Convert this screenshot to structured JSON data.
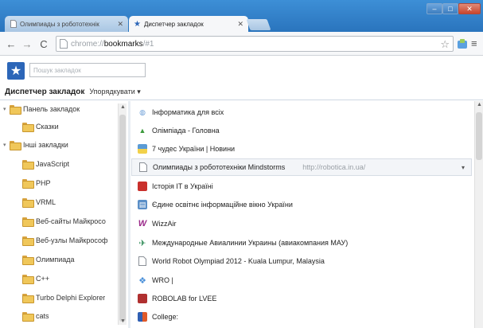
{
  "tabs": [
    {
      "label": "Олимпиады з робототехнік",
      "close": "✕",
      "active": false
    },
    {
      "label": "Диспетчер закладок",
      "close": "✕",
      "active": true
    }
  ],
  "window_controls": {
    "minimize": "–",
    "maximize": "□",
    "close": "✕"
  },
  "toolbar": {
    "back": "←",
    "forward": "→",
    "reload": "C",
    "url_scheme": "chrome://",
    "url_host": "bookmarks",
    "url_path": "/#1",
    "star": "☆",
    "menu": "≡"
  },
  "search": {
    "placeholder": "Пошук закладок",
    "value": ""
  },
  "manager": {
    "title": "Диспетчер закладок",
    "organize": "Упорядкувати ▾"
  },
  "tree": [
    {
      "label": "Панель закладок",
      "expanded": true,
      "level": 0
    },
    {
      "label": "Сказки",
      "level": 1
    },
    {
      "label": "Інші закладки",
      "expanded": true,
      "level": 0
    },
    {
      "label": "JavaScript",
      "level": 1
    },
    {
      "label": "PHP",
      "level": 1
    },
    {
      "label": "VRML",
      "level": 1
    },
    {
      "label": "Веб-сайты Майкросо",
      "level": 1
    },
    {
      "label": "Веб-узлы Майкрософ",
      "level": 1
    },
    {
      "label": "Олимпиада",
      "level": 1
    },
    {
      "label": "C++",
      "level": 1
    },
    {
      "label": "Turbo Delphi Explorer",
      "level": 1
    },
    {
      "label": "cats",
      "level": 1
    }
  ],
  "bookmarks": [
    {
      "title": "Інформатика для всіх",
      "url": "",
      "icon": "globe-icon",
      "color": "#6fa0d8",
      "glyph": "◍"
    },
    {
      "title": "Олімпіада - Головна",
      "url": "",
      "icon": "tree-icon",
      "color": "#3c9a3c",
      "glyph": "▲"
    },
    {
      "title": "7 чудес України | Новини",
      "url": "",
      "icon": "flag-icon",
      "color": "#e0c060",
      "glyph": "▬"
    },
    {
      "title": "Олимпиады з робототехніки Mindstorms",
      "url": "http://robotica.in.ua/",
      "icon": "page-icon",
      "color": "#ffffff",
      "glyph": "",
      "selected": true
    },
    {
      "title": "Історія IT в Україні",
      "url": "",
      "icon": "book-icon",
      "color": "#c9302c",
      "glyph": ""
    },
    {
      "title": "Єдине освітнє інформаційне вікно України",
      "url": "",
      "icon": "window-icon",
      "color": "#5b8fc7",
      "glyph": "▤"
    },
    {
      "title": "WizzAir",
      "url": "",
      "icon": "wizzair-icon",
      "color": "#9b2a8a",
      "glyph": "W"
    },
    {
      "title": "Международные Авиалинии Украины (авиакомпания МАУ)",
      "url": "",
      "icon": "plane-icon",
      "color": "#2e8b57",
      "glyph": "✈"
    },
    {
      "title": "World Robot Olympiad 2012 - Kuala Lumpur, Malaysia",
      "url": "",
      "icon": "page-icon",
      "color": "#ffffff",
      "glyph": ""
    },
    {
      "title": "WRO |",
      "url": "",
      "icon": "wro-icon",
      "color": "#4a90d9",
      "glyph": "❖"
    },
    {
      "title": "ROBOLAB for LVEE",
      "url": "",
      "icon": "robolab-icon",
      "color": "#b03030",
      "glyph": "▦"
    },
    {
      "title": "College:",
      "url": "",
      "icon": "college-icon",
      "color": "#2f5fb3",
      "glyph": "▙"
    }
  ],
  "row_menu": "▾",
  "colors": {
    "titlebar": "#3d8fd6",
    "logo": "#2c66b8",
    "folder": "#f0c75a"
  }
}
